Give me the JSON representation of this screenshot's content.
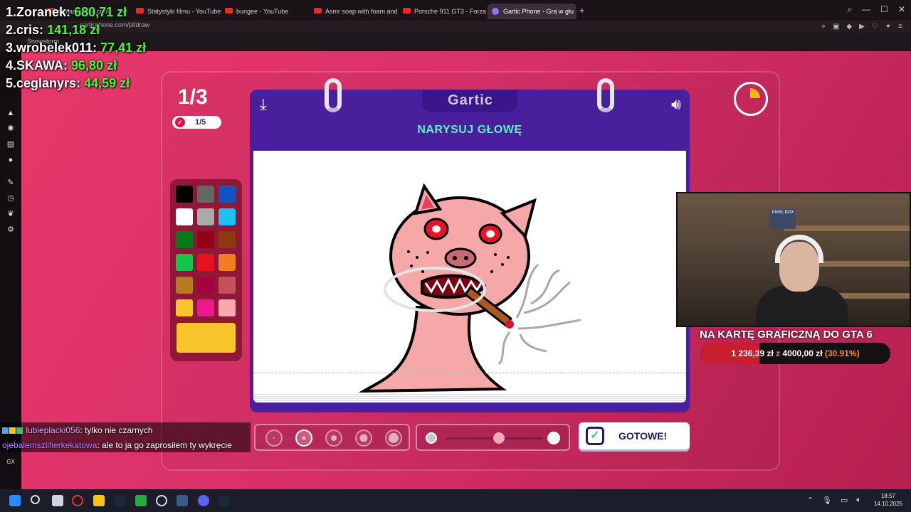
{
  "browser": {
    "tabs": [
      {
        "label": "tomaszewski.com"
      },
      {
        "label": "Statystyki filmu - YouTube"
      },
      {
        "label": "bungee - YouTube"
      },
      {
        "label": "Asmr soap with foam and"
      },
      {
        "label": "Porsche 911 GT3 - Forza"
      },
      {
        "label": "Gartic Phone - Gra w głu"
      }
    ],
    "url": "garticphone.com/pl/draw",
    "bookmark": "Snowstorm"
  },
  "leaderboard": [
    {
      "rank": "1.",
      "name": "Zoranek:",
      "amount": "680,71 zł"
    },
    {
      "rank": "2.",
      "name": "cris:",
      "amount": "141,18 zł"
    },
    {
      "rank": "3.",
      "name": "wrobelek011:",
      "amount": "77,41 zł"
    },
    {
      "rank": "4.",
      "name": "SKAWA:",
      "amount": "96,80 zł"
    },
    {
      "rank": "5.",
      "name": "ceglanyrs:",
      "amount": "44,59 zł"
    }
  ],
  "game": {
    "round": "1/3",
    "progress": "1/5",
    "logo": "Gartic",
    "prompt": "NARYSUJ GŁOWĘ",
    "done_label": "GOTOWE!",
    "timer_fraction_elapsed": 0.25,
    "brush_size_fraction": 0.55,
    "stroke_sizes": 5,
    "selected_stroke": 2,
    "selected_color": "#f7c42b",
    "palette": [
      "#000000",
      "#666666",
      "#1153bf",
      "#ffffff",
      "#aaaaaa",
      "#1ec2f2",
      "#0a7a17",
      "#930014",
      "#8f3a0e",
      "#16c44a",
      "#e5121e",
      "#f17e23",
      "#b8791f",
      "#a6003f",
      "#c4525a",
      "#f7c42b",
      "#e81a8c",
      "#f7a9ae"
    ]
  },
  "chat": [
    {
      "user": "lubieplacki056",
      "text": ": tylko nie czarnych"
    },
    {
      "user": "ojebalemszlifierkekatowa",
      "text": ": ale to ja go zaprosiłem ty wykręcie"
    }
  ],
  "goal": {
    "title": "NA KARTĘ GRAFICZNĄ DO GTA 6",
    "current": "1 236,39 zł",
    "sep": "z",
    "target": "4000,00 zł",
    "percent": "(30.91%)",
    "fraction": 0.3091
  },
  "webcam": {
    "box_text": "PIXEL BOX"
  },
  "taskbar": {
    "time": "18:57",
    "date": "14.10.2025"
  },
  "rail": {
    "gx": "GX"
  }
}
